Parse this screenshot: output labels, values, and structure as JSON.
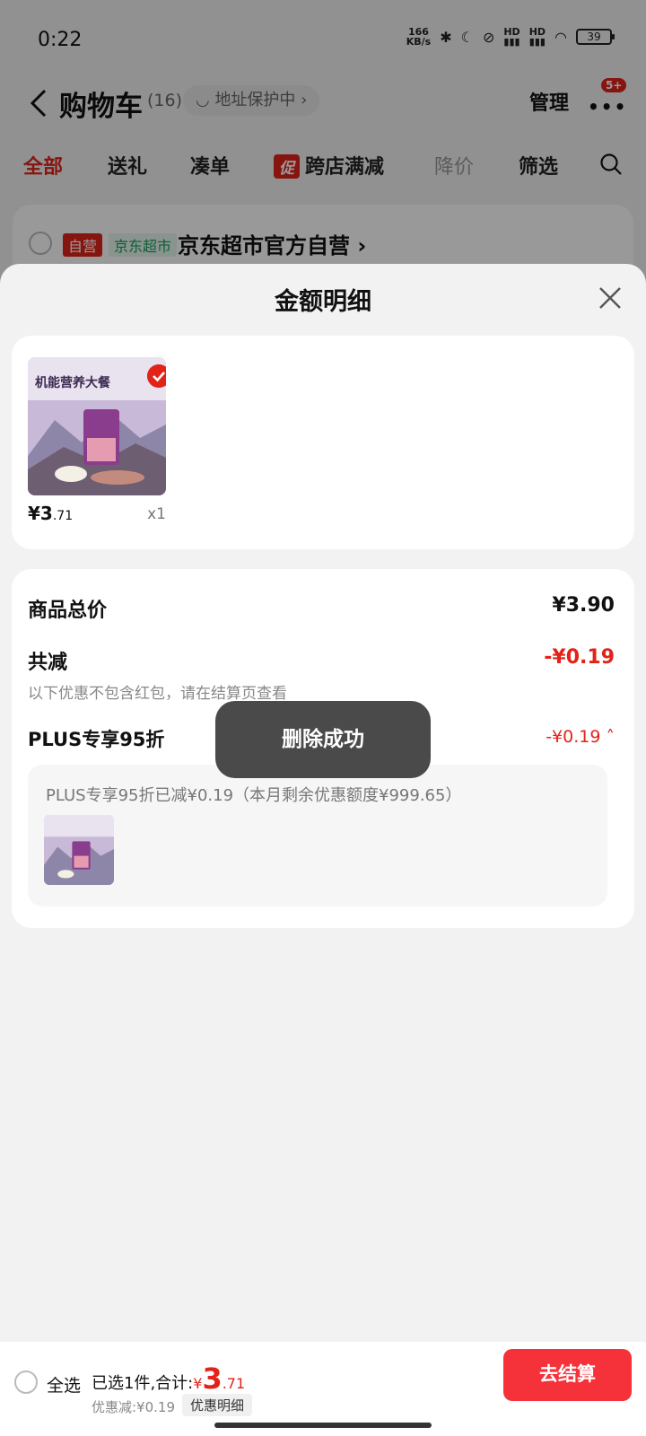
{
  "status_bar": {
    "time": "0:22",
    "network_speed_value": "166",
    "network_speed_unit": "KB/s",
    "signal_1": "HD",
    "signal_2": "HD",
    "battery": "39"
  },
  "header": {
    "title": "购物车",
    "count": "(16)",
    "address_status": "地址保护中",
    "manage_label": "管理",
    "more_badge": "5+"
  },
  "tabs": [
    {
      "label": "全部"
    },
    {
      "label": "送礼"
    },
    {
      "label": "凑单"
    },
    {
      "label": "跨店满减",
      "tag": "促"
    },
    {
      "label": "降价"
    },
    {
      "label": "筛选"
    }
  ],
  "store": {
    "self_run_tag": "自营",
    "channel_tag": "京东超市",
    "name": "京东超市官方自营"
  },
  "sheet": {
    "title": "金额明细",
    "product": {
      "image_text": "机能营养大餐",
      "price_symbol": "¥",
      "price_int": "3",
      "price_dec": ".71",
      "quantity": "x1"
    },
    "summary": {
      "total_label": "商品总价",
      "total_value": "¥3.90",
      "discount_label": "共减",
      "discount_value": "-¥0.19",
      "discount_note": "以下优惠不包含红包，请在结算页查看",
      "plus_label": "PLUS专享95折",
      "plus_value": "-¥0.19",
      "plus_desc": "PLUS专享95折已减¥0.19（本月剩余优惠额度¥999.65）"
    }
  },
  "toast": "删除成功",
  "bottom_bar": {
    "select_all": "全选",
    "selected_text": "已选1件,合计:",
    "total_symbol": "¥",
    "total_int": "3",
    "total_dec": ".71",
    "discount_text": "优惠减:¥0.19",
    "detail_link": "优惠明细",
    "checkout": "去结算"
  },
  "colors": {
    "accent": "#e2231a",
    "checkout": "#f5313a",
    "toast": "#4a4a4a"
  }
}
